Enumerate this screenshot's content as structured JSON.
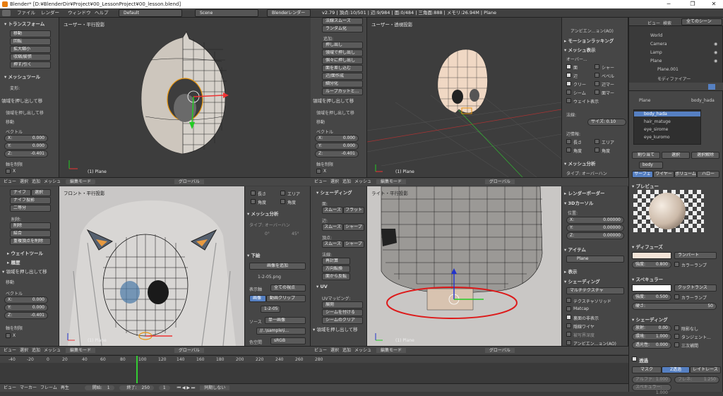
{
  "titlebar": {
    "text": "Blender* [D:¥BlenderDir¥Project¥00_LessonProject¥00_lesson.blend]",
    "minimize": "─",
    "restore": "❐",
    "close": "✕"
  },
  "menubar": {
    "items": [
      "ファイル",
      "レンダー",
      "ウィンドウ",
      "ヘルプ"
    ],
    "layout": "Default",
    "scene": "Scene",
    "engine": "Blenderレンダー",
    "stats": "v2.79 | 頂点:10/501 | 辺:9/984 | 面:0/484 | 三角面:888 | メモリ:26.94M | Plane"
  },
  "vp1": {
    "label": "ユーザー・平行投影",
    "foot": "(1) Plane"
  },
  "vp2": {
    "label": "ユーザー・透視投影",
    "foot": "(1) Plane"
  },
  "vp3": {
    "label": "フロント・平行投影",
    "foot": "(1) Plane"
  },
  "vp4": {
    "label": "ライト・平行投影",
    "foot": "(1) Plane"
  },
  "tl1": {
    "head": "▾ トランスフォーム",
    "b": [
      "移動",
      "回転",
      "拡大縮小",
      "収縮/膨張",
      "押す/引く"
    ],
    "head2": "▾ メッシュツール",
    "sub": "変形:",
    "op": "領域を押し出して移",
    "move": "移動",
    "vec": "ベクトル",
    "x": "X:",
    "xv": "0.000",
    "y": "Y:",
    "yv": "0.000",
    "z": "Z:",
    "zv": "-0.401",
    "axes": "軸を制限",
    "ax": "X"
  },
  "tl2": {
    "top": "法線スムーズ",
    "b1": "ランダム化",
    "sub": "追加:",
    "b": [
      "押し出し",
      "領域で押し出し",
      "個々に押し出し",
      "面を差し込む",
      "辺/面作成",
      "細分化",
      "ループカットと..."
    ],
    "op": "領域を押し出して移",
    "move": "移動",
    "vec": "ベクトル",
    "x": "X:",
    "xv": "0.000",
    "y": "Y:",
    "yv": "0.000",
    "z": "Z:",
    "zv": "-0.401",
    "axes": "軸を制限",
    "ax": "X"
  },
  "tl3": {
    "b": [
      "ナイフ",
      "選択",
      "ナイフ投影",
      "二等分"
    ],
    "del": "削除:",
    "d1": "削除",
    "d2": "結合",
    "d3": "重複頂点を削除",
    "h1": "▸ ウェイトツール",
    "h2": "▸ 履歴",
    "op": "▾ 領域を押し出して移",
    "move": "移動",
    "vec": "ベクトル",
    "x": "X:",
    "xv": "0.000",
    "y": "Y:",
    "yv": "0.000",
    "z": "Z:",
    "zv": "-0.401",
    "axes": "軸を制限",
    "ax": "X"
  },
  "tl4": {
    "head": "▾ シェーディング",
    "face": "面:",
    "s1": "スムーズ",
    "s2": "フラット",
    "edge": "辺:",
    "s3": "スムーズ",
    "s4": "シャープ",
    "vert": "頂点:",
    "s5": "スムーズ",
    "s6": "シャープ",
    "norm": "法線:",
    "n1": "再計算",
    "n2": "方向転換",
    "n3": "面から反転",
    "uvh": "▾ UV",
    "uvmap": "UVマッピング:",
    "u1": "展開",
    "u2": "シームを付ける",
    "u3": "シームのクリア",
    "op": "▾ 領域を押し出して移"
  },
  "np2": {
    "h1": "▸ モーションラッキング",
    "h2": "▾ メッシュ表示",
    "ov": "オーバー...",
    "c1": "面",
    "c2": "シャー",
    "c3": "辺",
    "c4": "ベベル",
    "c5": "クリー",
    "c6": "辺マー",
    "c7": "シーム",
    "c8": "面マー",
    "c9": "ウェイト表示",
    "norm": "法線:",
    "size": "サイズ: 0.10",
    "ed": "辺情報:",
    "e1": "長さ",
    "e2": "エリア",
    "e3": "角度",
    "e4": "角度",
    "h3": "▾ メッシュ分析",
    "type": "タイプ: オーバーハン",
    "top": "アンビエン...ョン(AO)"
  },
  "np3": {
    "c1": "長さ",
    "c2": "エリア",
    "c3": "角度",
    "c4": "角度",
    "h1": "▾ メッシュ分析",
    "type": "タイプ: オーバーハン",
    "d0": "0°",
    "d1": "45°",
    "h2": "▾ 下絵",
    "add": "画像を追加",
    "img": "1-2-05.png",
    "all": "全ての視点",
    "sl": "表示軸",
    "t1": "画像",
    "t2": "動画クリップ",
    "file": "1-2-05",
    "src": "ソース",
    "srcv": "単一画像",
    "path": "//..\\sample\\i...",
    "cs": "色空間",
    "csv": "sRGB"
  },
  "np4": {
    "h1": "▸ レンダーボーダー",
    "h2": "▾ 3Dカーソル",
    "loc": "位置:",
    "x": "X:",
    "xv": "0.00000",
    "y": "Y:",
    "yv": "0.00000",
    "z": "Z:",
    "zv": "0.00000",
    "h3": "▾ アイテム",
    "item": "Plane",
    "h4": "▸ 表示",
    "h5": "▾ シェーディング",
    "mt": "マルチテクスチャ",
    "c1": "テクスチャソリッド",
    "c2": "Matcap",
    "c3": "裏面の非表示",
    "c4": "隠線ワイヤ",
    "c5": "被写界深度",
    "c6": "アンビエン...ョン(AO)"
  },
  "outliner": {
    "h1": "ビュー",
    "h2": "検索",
    "h3": "全てのシーン",
    "items": [
      "World",
      "Camera",
      "Lamp",
      "Plane",
      "Plane.001",
      "モディファイアー"
    ]
  },
  "props": {
    "crumb1": "Plane",
    "crumb2": "body_hada",
    "slots": [
      "body_hada",
      "hair_matuge",
      "eye_sirome",
      "eye_kuromo"
    ],
    "assign": "割り当て",
    "select": "選択",
    "deselect": "選択解除",
    "mat": "body",
    "tabs": [
      "サーフェ",
      "ワイヤー",
      "ボリューム",
      "ハロー"
    ],
    "prev": "▾ プレビュー",
    "dif": "▾ ディフューズ",
    "lam": "ランバート",
    "int": "強度:",
    "intv": "0.800",
    "ramp": "カラーランプ",
    "spec": "▾ スペキュラー",
    "ct": "クックトランス",
    "sint": "強度:",
    "sintv": "0.500",
    "hard": "硬さ:",
    "hardv": "50",
    "shd": "▾ シェーディング",
    "emit": "放射:",
    "emitv": "0.00",
    "amb": "環境:",
    "ambv": "1.000",
    "tra": "透光性:",
    "trav": "0.000",
    "sl1": "陰影なし",
    "sl2": "タンジェント...",
    "sl3": "三次補間",
    "trans": "透過",
    "mask": "マスク",
    "zt": "Z透過",
    "rt": "レイトレース",
    "alpha": "アルファ:",
    "alphav": "1.000",
    "spec2": "スペキュラー:",
    "spec2v": "1.000",
    "fr": "フレネ:",
    "frv": "1.250"
  },
  "headers": {
    "view": "ビュー",
    "sel": "選択",
    "add": "追加",
    "mesh": "メッシュ",
    "mode": "編集モード",
    "orient": "グローバル"
  },
  "timeline": {
    "ticks": [
      "-40",
      "-20",
      "0",
      "20",
      "40",
      "60",
      "80",
      "100",
      "120",
      "140",
      "160",
      "180",
      "200",
      "220",
      "240",
      "260",
      "280"
    ],
    "view": "ビュー",
    "marker": "マーカー",
    "frame": "フレーム",
    "play": "再生",
    "start": "開始:",
    "startv": "1",
    "end": "終了:",
    "endv": "250",
    "cur": "1",
    "sync": "同期しない"
  },
  "colors": {
    "accent": "#5680c2",
    "orange": "#e87d0d",
    "viewport": "#3d3d3d",
    "panel": "#464646"
  }
}
